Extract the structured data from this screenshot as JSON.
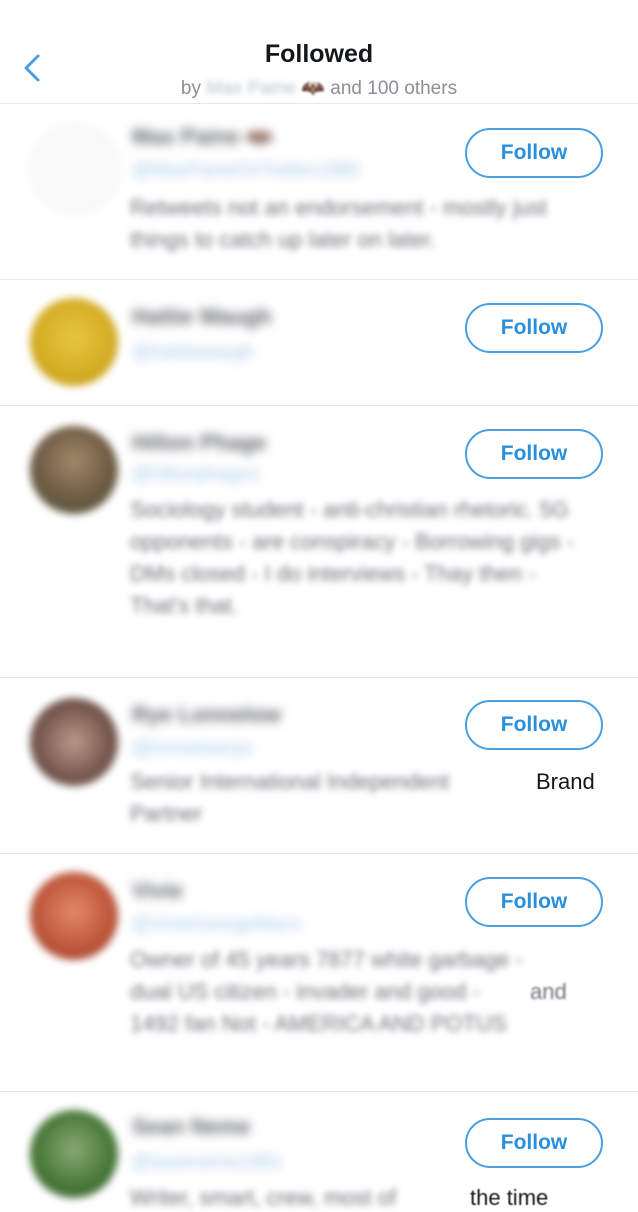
{
  "header": {
    "title": "Followed",
    "subtitle_prefix": "by",
    "subtitle_name": "Max Paine",
    "subtitle_emoji": "🦇",
    "subtitle_suffix": "and 100 others"
  },
  "users": [
    {
      "name": "Max Paine 🦇",
      "handle": "@MaxPaineOnTwitter1980",
      "bio": "Retweets not an endorsement - mostly just things to catch up later on later.",
      "avatar_color": "#f6f6f6",
      "follow_label": "Follow"
    },
    {
      "name": "Hattie Waugh",
      "handle": "@hattiewaugh",
      "bio": "",
      "avatar_color": "#d9b52a",
      "follow_label": "Follow"
    },
    {
      "name": "Hilton Phage",
      "handle": "@hiltonphage1",
      "bio": "Sociology student - anti-christian rhetoric. 5G opponents - are conspiracy - Borrowing gigs - DMs closed - I do interviews - Thay then - That's that.",
      "avatar_color": "#7d6a55",
      "follow_label": "Follow"
    },
    {
      "name": "Rye Lonnelow",
      "handle": "@lonnelowrye",
      "bio": "Senior International Independent",
      "bio_tail": "Brand",
      "bio_line2": "Partner",
      "avatar_color": "#8a6e64",
      "follow_label": "Follow"
    },
    {
      "name": "Vivie",
      "handle": "@VivieGeorgeMacs",
      "bio": "Owner of 45 years 7877 white garbage - dual US citizen - invader and good - 1492 fan Not - AMERICA AND POTUS",
      "bio_tail": "and",
      "avatar_color": "#c96a4a",
      "follow_label": "Follow"
    },
    {
      "name": "Sean Neme",
      "handle": "@seanneme1981",
      "bio": "Writer, smart, crew, most of",
      "bio_tail": "the time",
      "avatar_color": "#5a8a4a",
      "follow_label": "Follow"
    }
  ]
}
